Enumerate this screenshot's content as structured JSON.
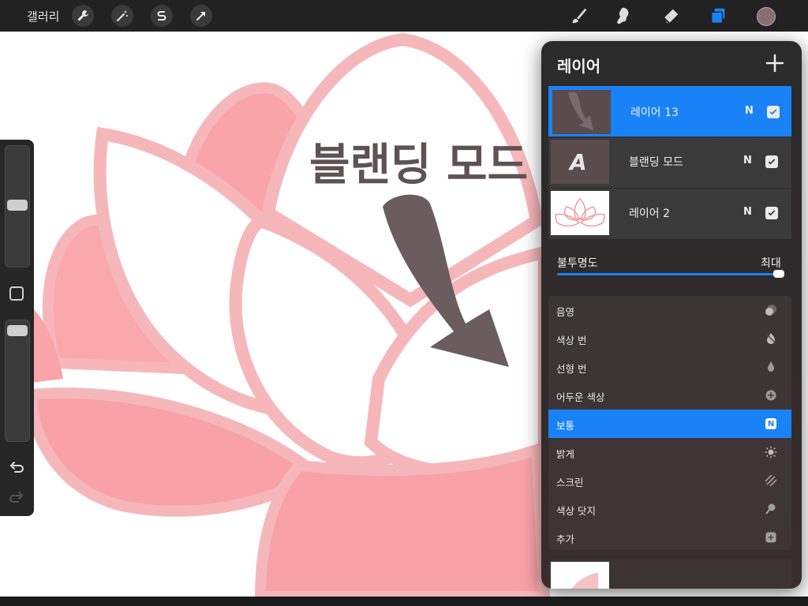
{
  "topbar": {
    "gallery_label": "갤러리",
    "left_tools": [
      {
        "icon": "wrench-icon"
      },
      {
        "icon": "magic-wand-icon"
      },
      {
        "icon": "selection-icon"
      },
      {
        "icon": "transform-arrow-icon"
      }
    ],
    "right_tools": [
      {
        "icon": "brush-icon"
      },
      {
        "icon": "smudge-icon"
      },
      {
        "icon": "eraser-icon"
      },
      {
        "icon": "layers-icon"
      }
    ],
    "current_color": "#8a6f72",
    "accent": "#1a82f7"
  },
  "canvas": {
    "heading": "블랜딩 모드",
    "arrow_color": "#6b5c5f",
    "petal_color": "#f7a4a9",
    "outline_color": "#f5b3b6"
  },
  "sidebar": {
    "undo_icon": "undo-icon",
    "redo_icon": "redo-icon"
  },
  "layers_panel": {
    "title": "레이어",
    "layers": [
      {
        "name": "레이어 13",
        "blend": "N",
        "visible": true,
        "active": true
      },
      {
        "name": "블랜딩 모드",
        "blend": "N",
        "visible": true,
        "active": false
      },
      {
        "name": "레이어 2",
        "blend": "N",
        "visible": true,
        "active": false
      }
    ],
    "opacity": {
      "label": "불투명도",
      "value_label": "최대",
      "value": 1.0
    },
    "blend_modes": [
      {
        "label": "음영",
        "icon": "multiply-icon",
        "active": false
      },
      {
        "label": "색상 번",
        "icon": "color-burn-icon",
        "active": false
      },
      {
        "label": "선형 번",
        "icon": "linear-burn-icon",
        "active": false
      },
      {
        "label": "어두운 색상",
        "icon": "darker-color-icon",
        "active": false
      },
      {
        "label": "보통",
        "icon": "normal-icon",
        "badge": "N",
        "active": true
      },
      {
        "label": "밝게",
        "icon": "lighten-icon",
        "active": false
      },
      {
        "label": "스크린",
        "icon": "screen-icon",
        "active": false
      },
      {
        "label": "색상 닷지",
        "icon": "color-dodge-icon",
        "active": false
      },
      {
        "label": "추가",
        "icon": "add-mode-icon",
        "active": false
      }
    ]
  }
}
